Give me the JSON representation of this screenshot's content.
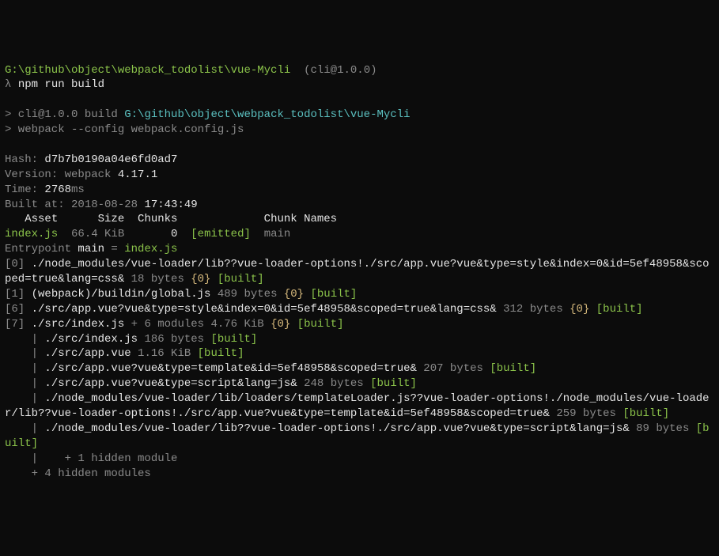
{
  "cwd": "G:\\github\\object\\webpack_todolist\\vue-Mycli",
  "cliver": "(cli@1.0.0)",
  "prompt": "λ ",
  "cmd1": "npm run build",
  "line2a": "> cli@1.0.0 build ",
  "line2b": "G:\\github\\object\\webpack_todolist\\vue-Mycli",
  "line3": "> webpack --config webpack.config.js",
  "hashLabel": "Hash: ",
  "hash": "d7b7b0190a04e6fd0ad7",
  "verLabel": "Version: ",
  "verA": "webpack ",
  "verB": "4.17.1",
  "timeLabel": "Time: ",
  "time": "2768",
  "timeUnit": "ms",
  "builtLabel": "Built at: ",
  "builtDate": "2018-08-28 ",
  "builtTime": "17:43:49",
  "hdr": "   Asset      Size  Chunks             Chunk Names",
  "assetName": "index.js",
  "assetRest": "  66.4 KiB       ",
  "assetChunk": "0",
  "assetEmitted": "[emitted]",
  "assetCN": "main",
  "entryA": "Entrypoint ",
  "entryMain": "main",
  "entryEq": " = ",
  "entryFile": "index.js",
  "m0idx": "[0] ",
  "m0path": "./node_modules/vue-loader/lib??vue-loader-options!./src/app.vue?vue&type=style&index=0&id=5ef48958&scoped=true&lang=css&",
  "m0size": " 18 bytes ",
  "m0chunk": "{0}",
  "m0built": " [built]",
  "m1idx": "[1] ",
  "m1path": "(webpack)/buildin/global.js",
  "m1size": " 489 bytes ",
  "m1chunk": "{0}",
  "m1built": " [built]",
  "m6idx": "[6] ",
  "m6path": "./src/app.vue?vue&type=style&index=0&id=5ef48958&scoped=true&lang=css&",
  "m6size": " 312 bytes ",
  "m6chunk": "{0}",
  "m6built": " [built]",
  "m7idx": "[7] ",
  "m7path": "./src/index.js",
  "m7plus": " + 6 modules",
  "m7size": " 4.76 KiB ",
  "m7chunk": "{0}",
  "m7built": " [built]",
  "s1pipe": "    | ",
  "s1path": "./src/index.js",
  "s1size": " 186 bytes ",
  "s1built": "[built]",
  "s2path": "./src/app.vue",
  "s2size": " 1.16 KiB ",
  "s2built": "[built]",
  "s3path": "./src/app.vue?vue&type=template&id=5ef48958&scoped=true&",
  "s3size": " 207 bytes ",
  "s3built": "[built]",
  "s4path": "./src/app.vue?vue&type=script&lang=js&",
  "s4size": " 248 bytes ",
  "s4built": "[built]",
  "s5path": "./node_modules/vue-loader/lib/loaders/templateLoader.js??vue-loader-options!./node_modules/vue-loader/lib??vue-loader-options!./src/app.vue?vue&type=template&id=5ef48958&scoped=true&",
  "s5size": " 259 bytes ",
  "s5built1": "[",
  "s5built2": "built",
  "s5built3": "]",
  "s6path": "./node_modules/vue-loader/lib??vue-loader-options!./src/app.vue?vue&type=script&lang=js&",
  "s6size": " 89 bytes ",
  "s6built": "[built]",
  "hidden1": "    |    + 1 hidden module",
  "hidden2": "    + 4 hidden modules"
}
